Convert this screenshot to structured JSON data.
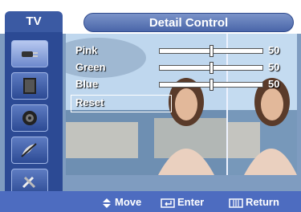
{
  "header": {
    "tab_label": "TV",
    "title": "Detail Control"
  },
  "sidebar": {
    "items": [
      {
        "icon": "plug-icon",
        "selected": true
      },
      {
        "icon": "panel-icon",
        "selected": false
      },
      {
        "icon": "speaker-icon",
        "selected": false
      },
      {
        "icon": "satellite-icon",
        "selected": false
      },
      {
        "icon": "tools-icon",
        "selected": false
      }
    ]
  },
  "menu": {
    "items": [
      {
        "label": "Pink",
        "value": "50",
        "slider_fraction": 0.5
      },
      {
        "label": "Green",
        "value": "50",
        "slider_fraction": 0.5
      },
      {
        "label": "Blue",
        "value": "50",
        "slider_fraction": 0.5
      },
      {
        "label": "Reset"
      }
    ],
    "selected": "Reset"
  },
  "footer": {
    "move": "Move",
    "enter": "Enter",
    "return": "Return"
  },
  "colors": {
    "accent": "#3b5aa3",
    "bar": "#4d6cc0",
    "selected_border": "#ffffff"
  }
}
